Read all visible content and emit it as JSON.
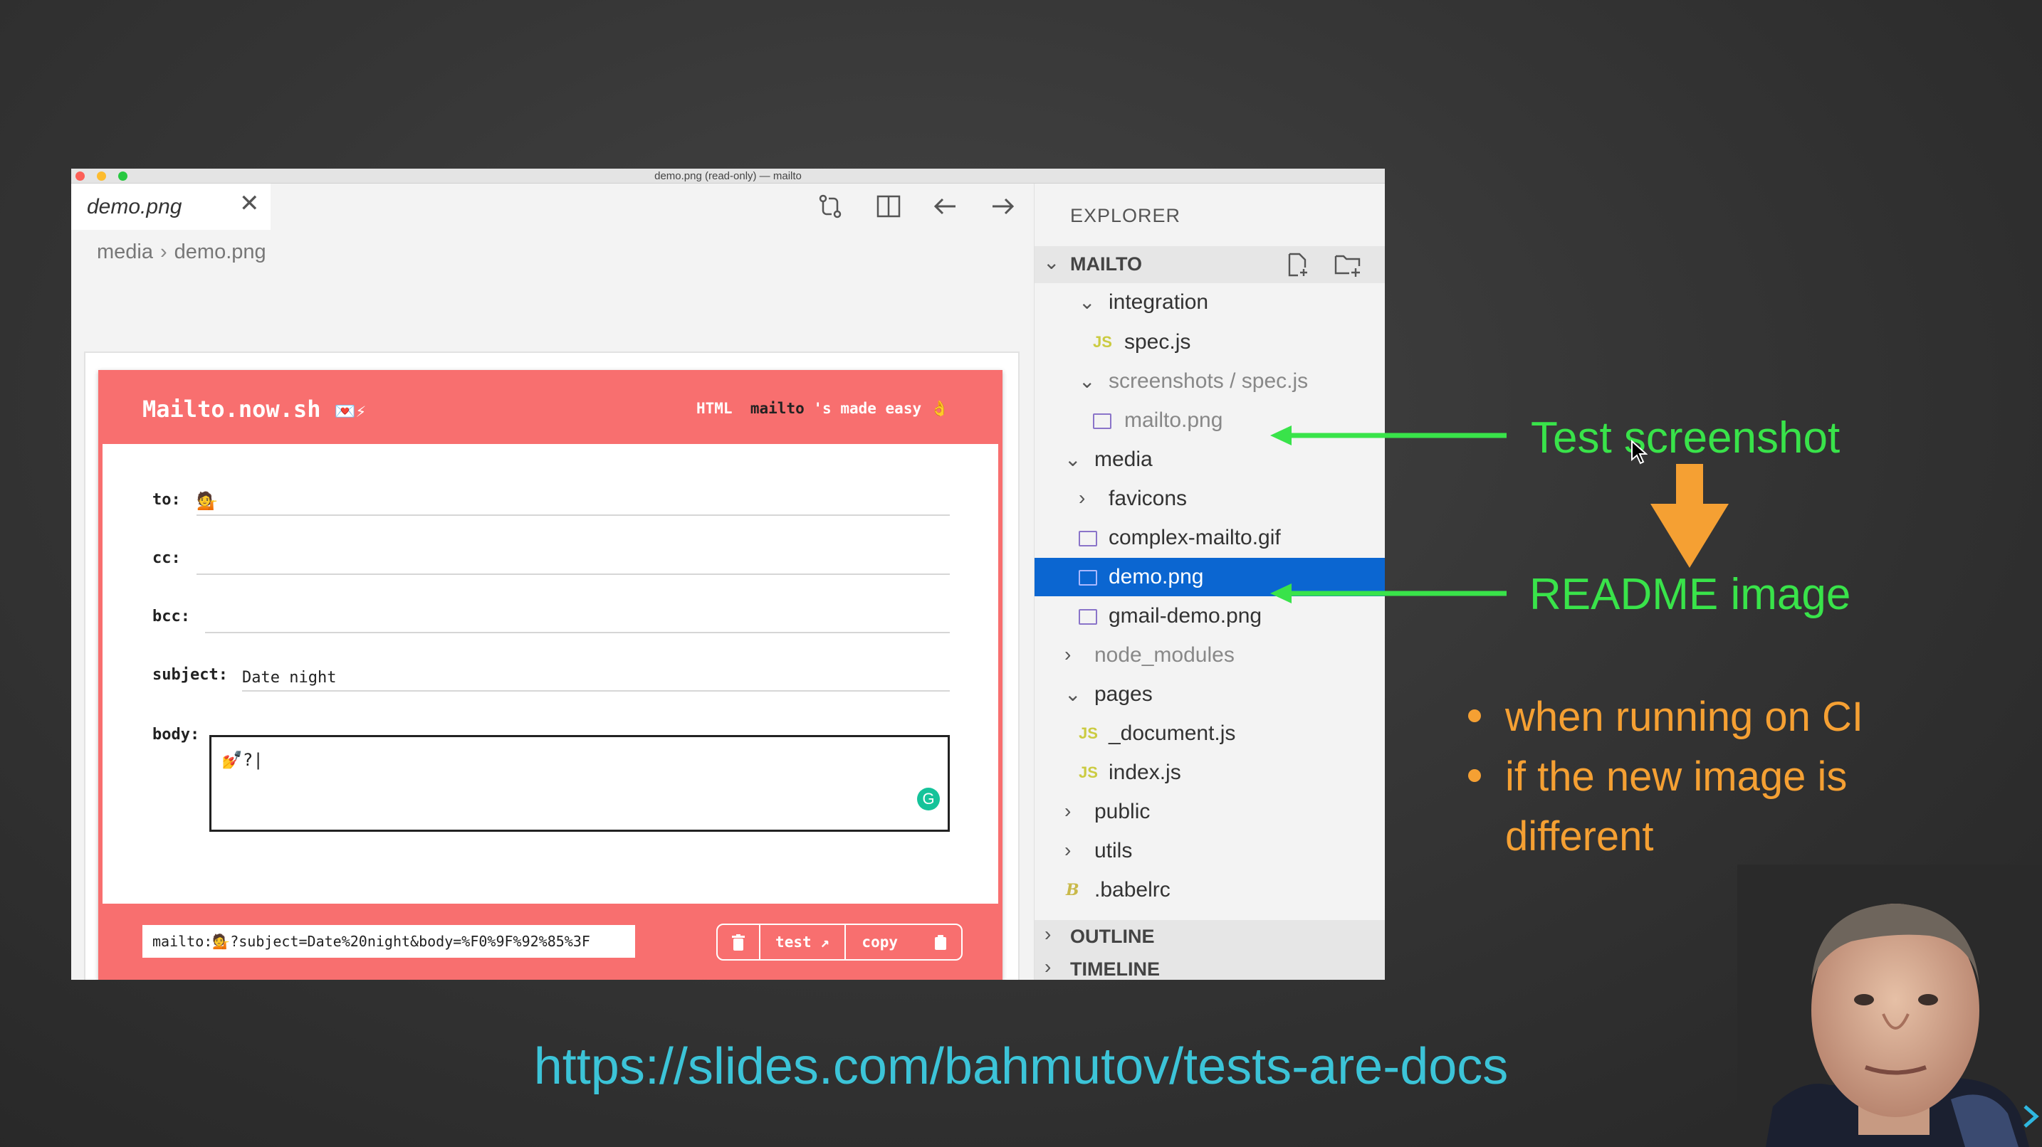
{
  "window": {
    "title": "demo.png (read-only) — mailto"
  },
  "editor": {
    "tab": {
      "label": "demo.png",
      "close": "✕"
    },
    "toolbar_icons": [
      "open-changes-icon",
      "split-editor-icon",
      "arrow-left-icon",
      "arrow-right-icon",
      "more-icon"
    ],
    "breadcrumb": [
      "media",
      "demo.png"
    ]
  },
  "mailto_app": {
    "title": "Mailto.now.sh",
    "title_emoji": "💌⚡",
    "tagline_prefix": "HTML",
    "tagline_bold": "mailto",
    "tagline_suffix": "'s made easy 👌",
    "fields": {
      "to_label": "to:",
      "to_value": "💁",
      "cc_label": "cc:",
      "cc_value": "",
      "bcc_label": "bcc:",
      "bcc_value": "",
      "subject_label": "subject:",
      "subject_value": "Date night",
      "body_label": "body:",
      "body_value": "💅?|"
    },
    "mailto_url": "mailto:💁?subject=Date%20night&body=%F0%9F%92%85%3F",
    "buttons": {
      "test": "test",
      "copy": "copy"
    }
  },
  "explorer": {
    "title": "EXPLORER",
    "section": "MAILTO",
    "tree": [
      {
        "name": "integration",
        "type": "folder-open"
      },
      {
        "name": "spec.js",
        "type": "js"
      },
      {
        "name": "screenshots / spec.js",
        "type": "folder-open"
      },
      {
        "name": "mailto.png",
        "type": "image"
      },
      {
        "name": "media",
        "type": "folder-open"
      },
      {
        "name": "favicons",
        "type": "folder-closed"
      },
      {
        "name": "complex-mailto.gif",
        "type": "image"
      },
      {
        "name": "demo.png",
        "type": "image",
        "selected": true
      },
      {
        "name": "gmail-demo.png",
        "type": "image"
      },
      {
        "name": "node_modules",
        "type": "folder-closed"
      },
      {
        "name": "pages",
        "type": "folder-open"
      },
      {
        "name": "_document.js",
        "type": "js"
      },
      {
        "name": "index.js",
        "type": "js"
      },
      {
        "name": "public",
        "type": "folder-closed"
      },
      {
        "name": "utils",
        "type": "folder-closed"
      },
      {
        "name": ".babelrc",
        "type": "babel"
      }
    ],
    "outline": "OUTLINE",
    "timeline": "TIMELINE"
  },
  "annotations": {
    "test_screenshot": "Test screenshot",
    "readme_image": "README image",
    "bullets": [
      "when running on CI",
      "if the new image is",
      "different"
    ]
  },
  "link": "https://slides.com/bahmutov/tests-are-docs",
  "colors": {
    "accent_green": "#39e34a",
    "accent_orange": "#f5a033",
    "link_cyan": "#3cc4d8",
    "app_red": "#f86f6f",
    "selection_blue": "#0b66d1"
  }
}
